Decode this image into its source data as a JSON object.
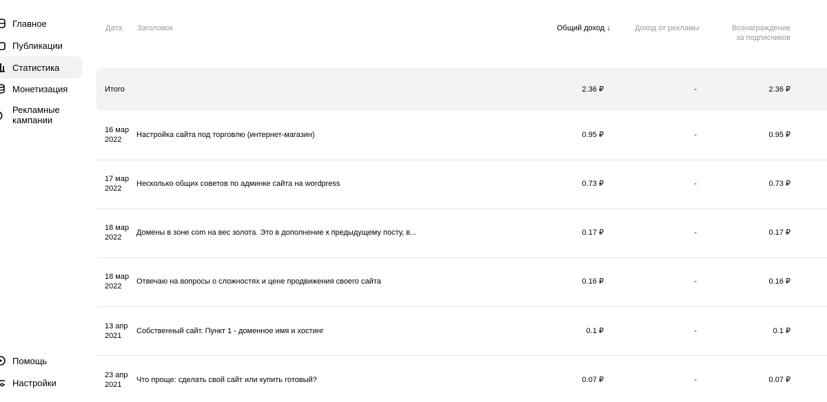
{
  "sidebar": {
    "items": [
      {
        "label": "Главное",
        "icon": "home-icon"
      },
      {
        "label": "Публикации",
        "icon": "publications-icon"
      },
      {
        "label": "Статистика",
        "icon": "statistics-icon",
        "active": true
      },
      {
        "label": "Монетизация",
        "icon": "monetization-icon"
      },
      {
        "label": "Рекламные кампании",
        "icon": "ad-campaigns-icon"
      }
    ],
    "bottom_items": [
      {
        "label": "Помощь",
        "icon": "help-icon"
      },
      {
        "label": "Настройки",
        "icon": "settings-icon"
      }
    ]
  },
  "table": {
    "columns": {
      "date": "Дата",
      "title": "Заголовок",
      "total_income": "Общий доход ↓",
      "ad_income_label": "Доход от рекламы",
      "subscriber_reward_line1": "Вознаграждение",
      "subscriber_reward_line2": "за подписчиков"
    },
    "total_row": {
      "label": "Итого",
      "total_income": "2.36 ₽",
      "ad_income": "-",
      "subscriber_reward": "2.36 ₽"
    },
    "rows": [
      {
        "date_line1": "16 мар",
        "date_line2": "2022",
        "title": "Настройка сайта под торговлю (интернет-магазин)",
        "total_income": "0.95 ₽",
        "ad_income": "-",
        "subscriber_reward": "0.95 ₽"
      },
      {
        "date_line1": "17 мар",
        "date_line2": "2022",
        "title": "Несколько общих советов по админке сайта на wordpress",
        "total_income": "0.73 ₽",
        "ad_income": "-",
        "subscriber_reward": "0.73 ₽"
      },
      {
        "date_line1": "18 мар",
        "date_line2": "2022",
        "title": "Домены в зоне com на вес золота. Это в дополнение к предыдущему посту, в...",
        "total_income": "0.17 ₽",
        "ad_income": "-",
        "subscriber_reward": "0.17 ₽"
      },
      {
        "date_line1": "18 мар",
        "date_line2": "2022",
        "title": "Отвечаю на вопросы о сложностях и цене продвижения своего сайта",
        "total_income": "0.16 ₽",
        "ad_income": "-",
        "subscriber_reward": "0.16 ₽"
      },
      {
        "date_line1": "13 апр",
        "date_line2": "2021",
        "title": "Собственный сайт. Пункт 1 - доменное имя и хостинг",
        "total_income": "0.1 ₽",
        "ad_income": "-",
        "subscriber_reward": "0.1 ₽"
      },
      {
        "date_line1": "23 апр",
        "date_line2": "2021",
        "title": "Что проще: сделать свой сайт или купить готовый?",
        "total_income": "0.07 ₽",
        "ad_income": "-",
        "subscriber_reward": "0.07 ₽"
      }
    ]
  }
}
